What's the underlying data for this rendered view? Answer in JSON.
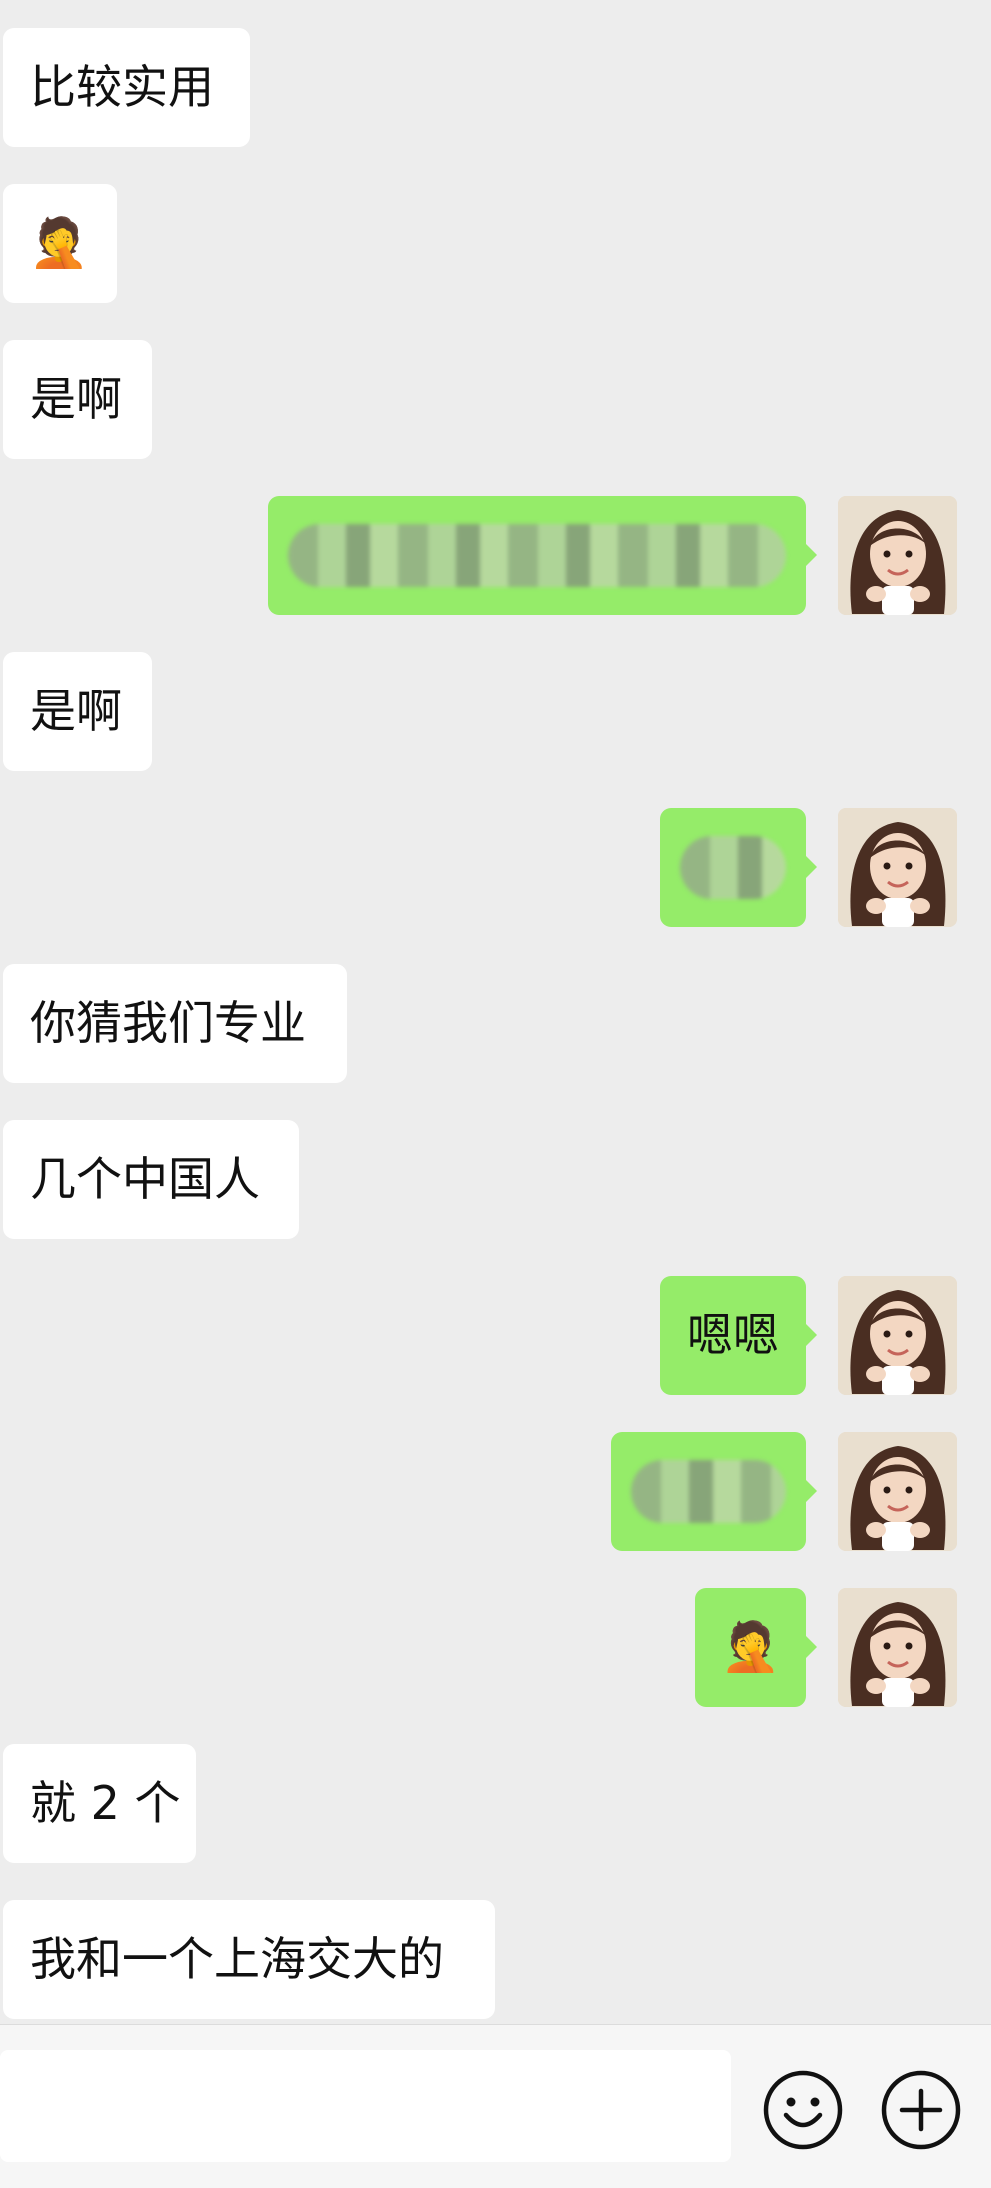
{
  "chat": {
    "messages": [
      {
        "id": 1,
        "side": "incoming",
        "text": "比较实用"
      },
      {
        "id": 2,
        "side": "incoming",
        "text": "🤦"
      },
      {
        "id": 3,
        "side": "incoming",
        "text": "是啊"
      },
      {
        "id": 4,
        "side": "outgoing",
        "text": "",
        "redacted": true
      },
      {
        "id": 5,
        "side": "incoming",
        "text": "是啊"
      },
      {
        "id": 6,
        "side": "outgoing",
        "text": "",
        "redacted": true
      },
      {
        "id": 7,
        "side": "incoming",
        "text": "你猜我们专业"
      },
      {
        "id": 8,
        "side": "incoming",
        "text": "几个中国人"
      },
      {
        "id": 9,
        "side": "outgoing",
        "text": "嗯嗯"
      },
      {
        "id": 10,
        "side": "outgoing",
        "text": "",
        "redacted": true
      },
      {
        "id": 11,
        "side": "outgoing",
        "text": "🤦"
      },
      {
        "id": 12,
        "side": "incoming",
        "text": "就 2 个"
      },
      {
        "id": 13,
        "side": "incoming",
        "text": "我和一个上海交大的"
      }
    ]
  },
  "input_bar": {
    "text_value": "",
    "emoji_icon": "smiley-face-icon",
    "more_icon": "plus-circle-icon"
  },
  "colors": {
    "background": "#ededed",
    "incoming_bubble": "#ffffff",
    "outgoing_bubble": "#95ec69",
    "input_bar": "#f6f6f6"
  }
}
